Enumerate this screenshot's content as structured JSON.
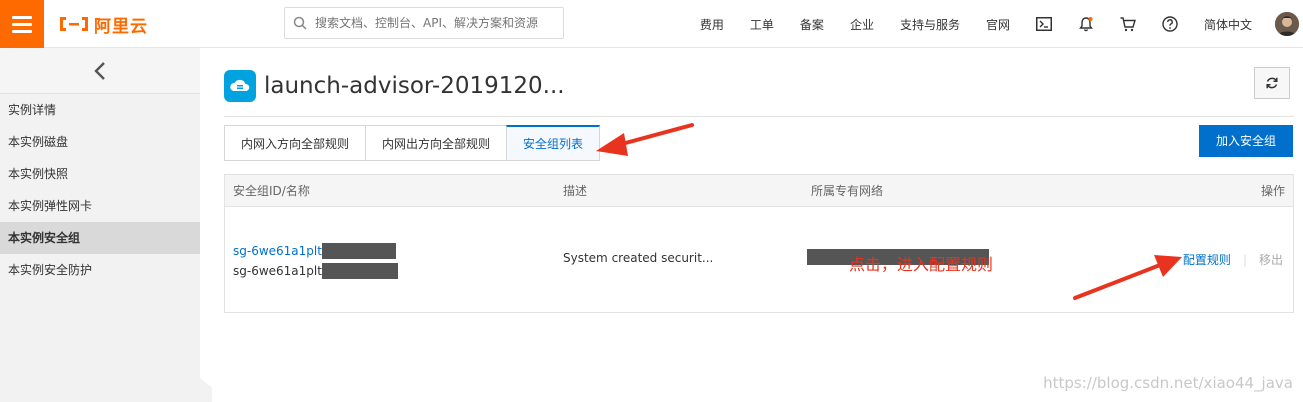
{
  "header": {
    "brand": "阿里云",
    "search_placeholder": "搜索文档、控制台、API、解决方案和资源",
    "nav": [
      "费用",
      "工单",
      "备案",
      "企业",
      "支持与服务",
      "官网"
    ],
    "language": "简体中文",
    "icons": [
      "terminal-icon",
      "bell-icon",
      "cart-icon",
      "help-icon"
    ]
  },
  "sidebar": {
    "items": [
      {
        "label": "实例详情",
        "active": false
      },
      {
        "label": "本实例磁盘",
        "active": false
      },
      {
        "label": "本实例快照",
        "active": false
      },
      {
        "label": "本实例弹性网卡",
        "active": false
      },
      {
        "label": "本实例安全组",
        "active": true
      },
      {
        "label": "本实例安全防护",
        "active": false
      }
    ]
  },
  "main": {
    "title": "launch-advisor-2019120...",
    "tabs": [
      "内网入方向全部规则",
      "内网出方向全部规则",
      "安全组列表"
    ],
    "active_tab": 2,
    "join_button": "加入安全组",
    "table": {
      "headers": [
        "安全组ID/名称",
        "描述",
        "所属专有网络",
        "操作"
      ],
      "rows": [
        {
          "id": "sg-6we61a1plt",
          "name": "sg-6we61a1plt",
          "description": "System created securit...",
          "actions": [
            "配置规则",
            "移出"
          ]
        }
      ]
    }
  },
  "annotation": "点击，进入配置规则",
  "watermark": "https://blog.csdn.net/xiao44_java",
  "colors": {
    "brand_orange": "#ff6a00",
    "link_blue": "#0070cc",
    "annotation_red": "#e8331f"
  }
}
